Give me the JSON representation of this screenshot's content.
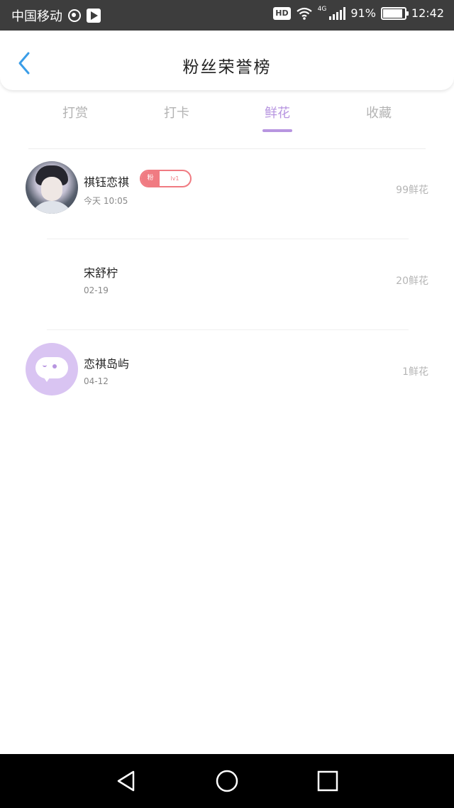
{
  "status_bar": {
    "carrier": "中国移动",
    "hd": "HD",
    "network": "4G",
    "battery": "91%",
    "battery_level": 0.91,
    "time": "12:42",
    "icons": [
      "weibo-icon",
      "play-icon",
      "wifi-icon",
      "signal-icon",
      "battery-icon"
    ]
  },
  "header": {
    "title": "粉丝荣誉榜",
    "back_icon": "back-chevron-icon"
  },
  "tabs": {
    "items": [
      {
        "label": "打赏",
        "active": false
      },
      {
        "label": "打卡",
        "active": false
      },
      {
        "label": "鲜花",
        "active": true
      },
      {
        "label": "收藏",
        "active": false
      }
    ]
  },
  "list": {
    "items": [
      {
        "name": "祺钰恋祺",
        "date": "今天 10:05",
        "amount": "99鲜花",
        "avatar": "photo-avatar",
        "badge": {
          "left": "粉",
          "right": "lv1"
        }
      },
      {
        "name": "宋舒柠",
        "date": "02-19",
        "amount": "20鲜花",
        "avatar": "none"
      },
      {
        "name": "恋祺岛屿",
        "date": "04-12",
        "amount": "1鲜花",
        "avatar": "chat-bubble-avatar"
      }
    ]
  },
  "nav_bar": {
    "icons": [
      "back-triangle-icon",
      "home-circle-icon",
      "recents-square-icon"
    ]
  },
  "colors": {
    "accent": "#b795e0",
    "badge": "#f07b82",
    "status_bar": "#3d3d3d",
    "nav_bar": "#000000",
    "back_arrow": "#3a9de8"
  }
}
